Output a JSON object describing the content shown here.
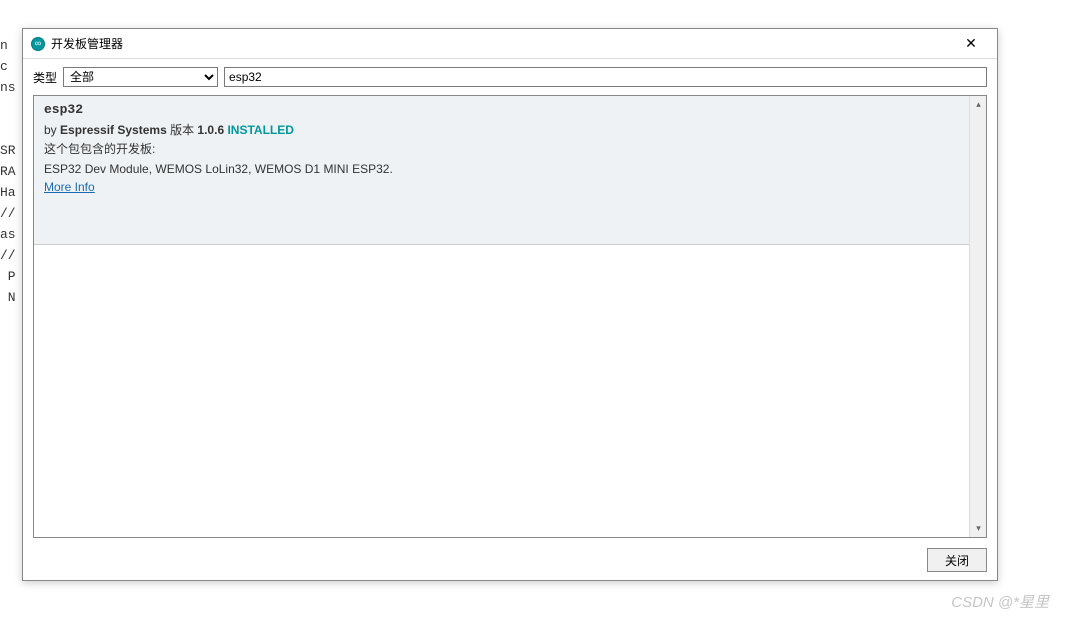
{
  "background_lines": "n\nc\nns\n\n\nSR\nRA\nHa\n//\nas\n//\n P\n N",
  "dialog": {
    "title": "开发板管理器",
    "close_x": "✕"
  },
  "filter": {
    "type_label": "类型",
    "type_value": "全部",
    "search_value": "esp32"
  },
  "result": {
    "name": "esp32",
    "by_prefix": "by ",
    "author": "Espressif Systems",
    "version_label": " 版本 ",
    "version": "1.0.6",
    "installed": "INSTALLED",
    "includes_label": "这个包包含的开发板:",
    "boards": "ESP32 Dev Module, WEMOS LoLin32, WEMOS D1 MINI ESP32.",
    "more_info": "More Info"
  },
  "footer": {
    "close_label": "关闭"
  },
  "watermark": "CSDN @*星里"
}
